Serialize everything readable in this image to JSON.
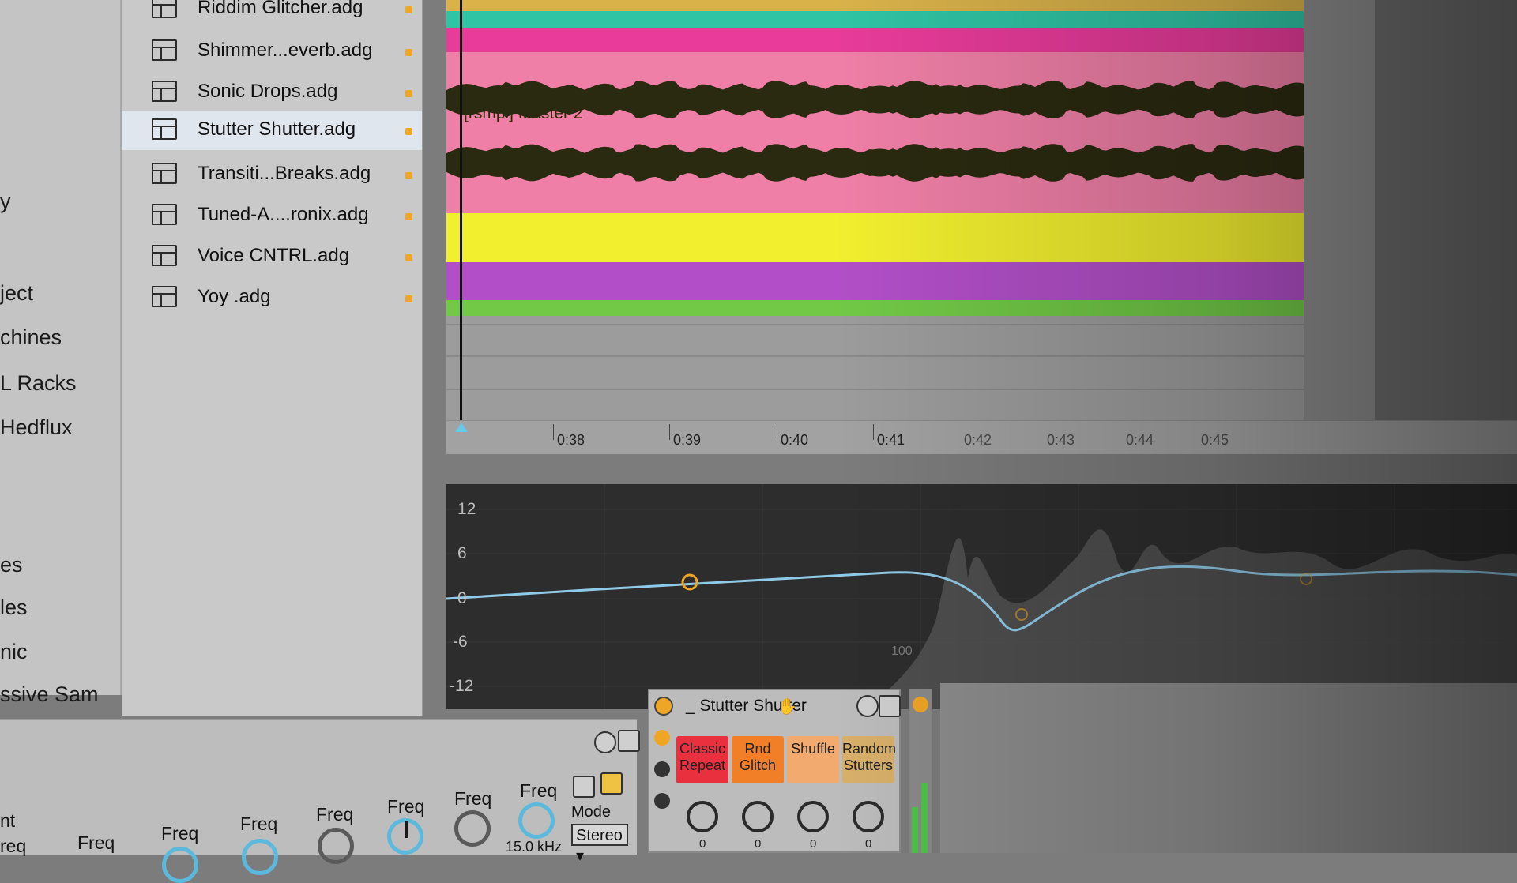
{
  "browser": {
    "sidebar_items": [
      "y",
      "ject",
      "chines",
      "L Racks",
      "Hedflux",
      "es",
      "les",
      "nic",
      "ssive Sam"
    ],
    "files": [
      {
        "name": "Riddim Glitcher.adg",
        "selected": false
      },
      {
        "name": "Shimmer...everb.adg",
        "selected": false
      },
      {
        "name": "Sonic Drops.adg",
        "selected": false
      },
      {
        "name": "Stutter Shutter.adg",
        "selected": true
      },
      {
        "name": "Transiti...Breaks.adg",
        "selected": false
      },
      {
        "name": "Tuned-A....ronix.adg",
        "selected": false
      },
      {
        "name": "Voice CNTRL.adg",
        "selected": false
      },
      {
        "name": "Yoy .adg",
        "selected": false
      }
    ],
    "file_prefix": "_"
  },
  "arrangement": {
    "clip_title": "[rsmpl] Master 2",
    "lane_colors": [
      "#d9b24a",
      "#2fc4a4",
      "#e83b9a",
      "#ef7fa6",
      "#f2ef2f",
      "#b24fc8",
      "#71c946",
      "#d0b46a"
    ],
    "ruler": [
      "0:38",
      "0:39",
      "0:40",
      "0:41",
      "0:42",
      "0:43",
      "0:44",
      "0:45"
    ]
  },
  "eq": {
    "db_labels": [
      "12",
      "6",
      "0",
      "-6",
      "-12"
    ],
    "freq_label": "100",
    "curve_color": "#8fcbe8",
    "band_point_color": "#f0a625"
  },
  "device": {
    "knob_label": "Freq",
    "left_label": "nt",
    "partial_label": "req",
    "freq_value": "15.0 kHz",
    "mode_label": "Mode",
    "mode_value": "Stereo ▾"
  },
  "rack": {
    "title": "_ Stutter Shutter",
    "hand_icon": "hand-icon",
    "macros": [
      {
        "label": "Classic Repeat",
        "color": "#e8303f",
        "value": "0"
      },
      {
        "label": "Rnd Glitch",
        "color": "#f07f28",
        "value": "0"
      },
      {
        "label": "Shuffle",
        "color": "#f2aa6e",
        "value": "0"
      },
      {
        "label": "Random Stutters",
        "color": "#d8b06a",
        "value": "0"
      }
    ]
  }
}
